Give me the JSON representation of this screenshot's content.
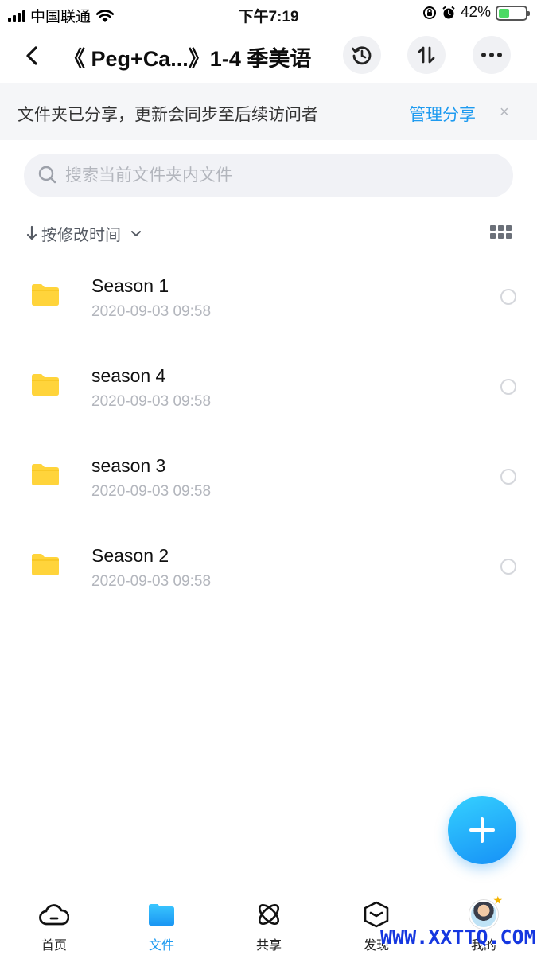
{
  "status_bar": {
    "carrier": "中国联通",
    "time": "下午7:19",
    "battery_percent": "42%",
    "battery_level": 0.42
  },
  "nav": {
    "title": "《 Peg+Ca...》1-4 季美语",
    "icons": [
      "back-icon",
      "history-icon",
      "sort-swap-icon",
      "more-icon"
    ]
  },
  "banner": {
    "text": "文件夹已分享，更新会同步至后续访问者",
    "link": "管理分享",
    "close": "×"
  },
  "search": {
    "placeholder": "搜索当前文件夹内文件",
    "value": ""
  },
  "sort": {
    "label": "按修改时间"
  },
  "files": [
    {
      "name": "Season 1",
      "date": "2020-09-03 09:58"
    },
    {
      "name": "season 4",
      "date": "2020-09-03 09:58"
    },
    {
      "name": "season 3",
      "date": "2020-09-03 09:58"
    },
    {
      "name": "Season 2",
      "date": "2020-09-03 09:58"
    }
  ],
  "tabs": [
    {
      "label": "首页",
      "icon": "cloud-icon"
    },
    {
      "label": "文件",
      "icon": "folder-icon",
      "active": true
    },
    {
      "label": "共享",
      "icon": "orbit-icon"
    },
    {
      "label": "发现",
      "icon": "box-icon"
    },
    {
      "label": "我的",
      "icon": "avatar"
    }
  ],
  "watermark": "WWW.XXTTQ.COM",
  "colors": {
    "accent": "#1e9bf0",
    "folder": "#ffd43b",
    "fab": "#1e9bf0",
    "watermark": "#1537e0"
  }
}
